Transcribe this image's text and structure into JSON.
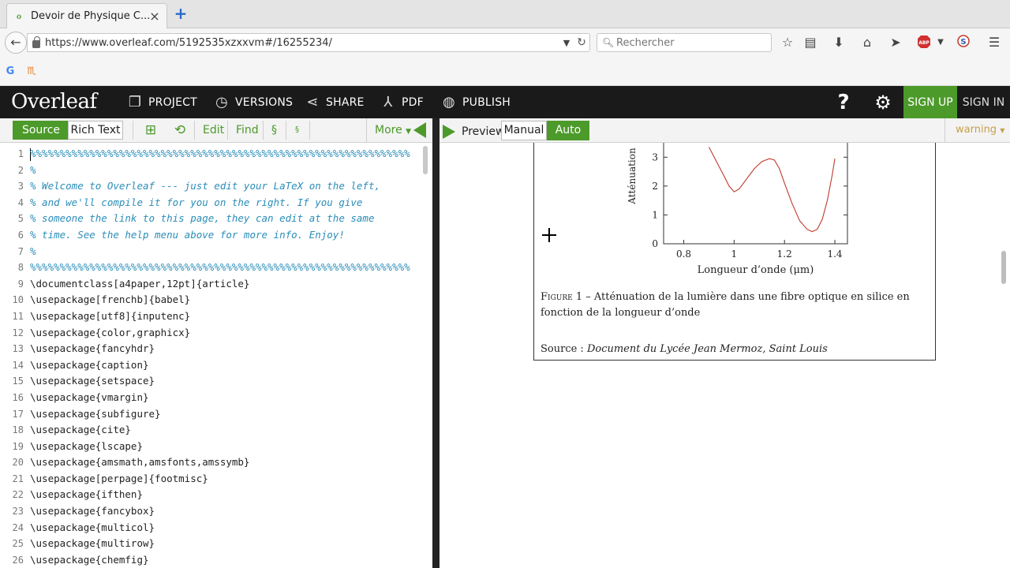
{
  "browser": {
    "tab_title": "Devoir de Physique C...",
    "url": "https://www.overleaf.com/5192535xzxxvm#/16255234/",
    "search_placeholder": "Rechercher"
  },
  "header": {
    "logo": "Overleaf",
    "menu": {
      "project": "PROJECT",
      "versions": "VERSIONS",
      "share": "SHARE",
      "pdf": "PDF",
      "publish": "PUBLISH"
    },
    "help": "?",
    "sign_up": "SIGN UP",
    "sign_in": "SIGN IN"
  },
  "editor_toolbar": {
    "source": "Source",
    "rich_text": "Rich Text",
    "edit": "Edit",
    "find": "Find",
    "section": "§",
    "subsection": "§",
    "more": "More"
  },
  "preview_toolbar": {
    "preview": "Preview",
    "manual": "Manual",
    "auto": "Auto",
    "warning": "warning"
  },
  "editor": {
    "lines": [
      "%%%%%%%%%%%%%%%%%%%%%%%%%%%%%%%%%%%%%%%%%%%%%%%%%%%%%%%%%%%%%%%%",
      "%",
      "% Welcome to Overleaf --- just edit your LaTeX on the left,",
      "% and we'll compile it for you on the right. If you give",
      "% someone the link to this page, they can edit at the same",
      "% time. See the help menu above for more info. Enjoy!",
      "%",
      "%%%%%%%%%%%%%%%%%%%%%%%%%%%%%%%%%%%%%%%%%%%%%%%%%%%%%%%%%%%%%%%%",
      "\\documentclass[a4paper,12pt]{article}",
      "\\usepackage[frenchb]{babel}",
      "\\usepackage[utf8]{inputenc}",
      "\\usepackage{color,graphicx}",
      "\\usepackage{fancyhdr}",
      "\\usepackage{caption}",
      "\\usepackage{setspace}",
      "\\usepackage{vmargin}",
      "\\usepackage{subfigure}",
      "\\usepackage{cite}",
      "\\usepackage{lscape}",
      "\\usepackage{amsmath,amsfonts,amssymb}",
      "\\usepackage[perpage]{footmisc}",
      "\\usepackage{ifthen}",
      "\\usepackage{fancybox}",
      "\\usepackage{multicol}",
      "\\usepackage{multirow}",
      "\\usepackage{chemfig}"
    ],
    "line_numbers": [
      "1",
      "2",
      "3",
      "4",
      "5",
      "6",
      "7",
      "8",
      "9",
      "10",
      "11",
      "12",
      "13",
      "14",
      "15",
      "16",
      "17",
      "18",
      "19",
      "20",
      "21",
      "22",
      "23",
      "24",
      "25",
      "26"
    ]
  },
  "preview": {
    "caption_label": "Figure 1",
    "caption_text": " – Atténuation de la lumière dans une fibre optique en silice en fonction de la longueur d’onde",
    "source_label": "Source : ",
    "source_text": "Document du Lycée Jean Mermoz, Saint Louis"
  },
  "chart_data": {
    "type": "line",
    "title": "",
    "xlabel": "Longueur d’onde (μm)",
    "ylabel": "Atténuation",
    "xlim": [
      0.72,
      1.45
    ],
    "ylim": [
      0,
      3.5
    ],
    "x_ticks": [
      0.8,
      1,
      1.2,
      1.4
    ],
    "x_tick_labels": [
      "0.8",
      "1",
      "1.2",
      "1.4"
    ],
    "y_ticks": [
      0,
      1,
      2,
      3
    ],
    "y_tick_labels": [
      "0",
      "1",
      "2",
      "3"
    ],
    "series": [
      {
        "color": "#c0392b",
        "x": [
          0.9,
          0.93,
          0.96,
          0.98,
          1.0,
          1.02,
          1.05,
          1.08,
          1.11,
          1.14,
          1.16,
          1.18,
          1.2,
          1.23,
          1.26,
          1.29,
          1.31,
          1.33,
          1.35,
          1.37,
          1.39,
          1.4
        ],
        "y": [
          3.35,
          2.85,
          2.35,
          2.0,
          1.8,
          1.9,
          2.25,
          2.6,
          2.85,
          2.95,
          2.9,
          2.6,
          2.1,
          1.4,
          0.8,
          0.5,
          0.42,
          0.5,
          0.85,
          1.5,
          2.4,
          2.95
        ]
      }
    ]
  }
}
